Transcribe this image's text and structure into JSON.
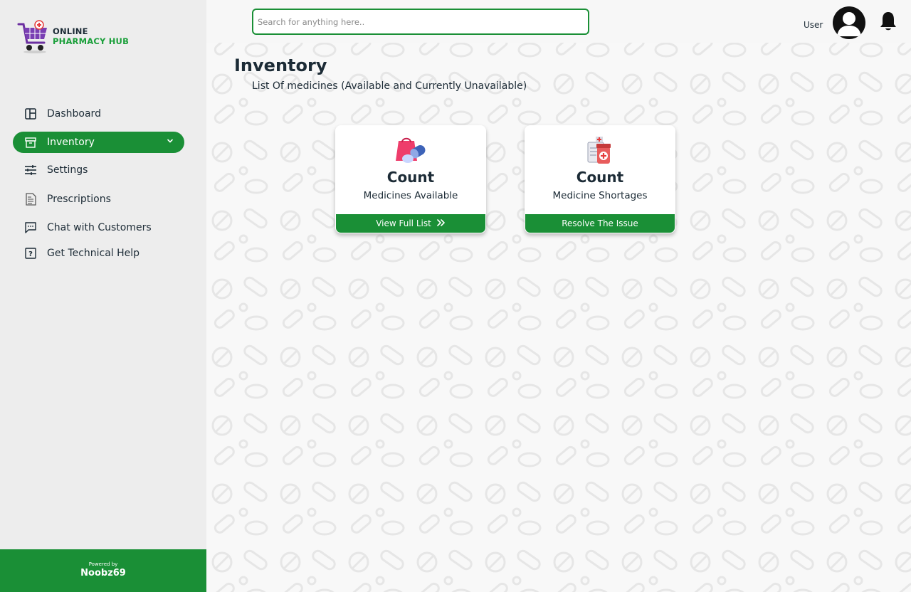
{
  "app": {
    "logo": {
      "line1": "ONLINE",
      "line2": "PHARMACY HUB"
    }
  },
  "sidebar": {
    "items": [
      {
        "label": "Dashboard",
        "icon": "dashboard-icon"
      },
      {
        "label": "Inventory",
        "icon": "inventory-icon",
        "active": true
      },
      {
        "label": "Settings",
        "icon": "sliders-icon"
      },
      {
        "label": "Prescriptions",
        "icon": "prescription-icon"
      },
      {
        "label": "Chat with Customers",
        "icon": "chat-icon"
      },
      {
        "label": "Get Technical Help",
        "icon": "help-icon"
      }
    ],
    "footer": {
      "powered_by": "Powered by",
      "brand": "Noobz69"
    }
  },
  "header": {
    "search": {
      "placeholder": "Search for anything here..",
      "value": ""
    },
    "user_label": "User"
  },
  "main": {
    "title": "Inventory",
    "subtitle": "List Of medicines (Available and Currently Unavailable)",
    "cards": [
      {
        "count": "Count",
        "label": "Medicines Available",
        "button": "View Full List",
        "button_icon": "double-chevron-right-icon"
      },
      {
        "count": "Count",
        "label": "Medicine Shortages",
        "button": "Resolve The Issue"
      }
    ]
  },
  "colors": {
    "accent": "#1a8f36",
    "text": "#1c2b36",
    "sidebar_bg": "#ededed"
  }
}
